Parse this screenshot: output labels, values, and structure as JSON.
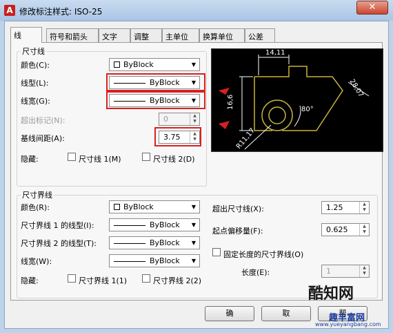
{
  "window": {
    "title": "修改标注样式: ISO-25",
    "close_glyph": "✕",
    "app_icon_letter": "A"
  },
  "tabs": [
    "线",
    "符号和箭头",
    "文字",
    "调整",
    "主单位",
    "换算单位",
    "公差"
  ],
  "dimension_lines": {
    "group_title": "尺寸线",
    "color_label": "颜色(C):",
    "color_value": "ByBlock",
    "linetype_label": "线型(L):",
    "linetype_value": "ByBlock",
    "lineweight_label": "线宽(G):",
    "lineweight_value": "ByBlock",
    "extend_ticks_label": "超出标记(N):",
    "extend_ticks_value": "0",
    "baseline_spacing_label": "基线间距(A):",
    "baseline_spacing_value": "3.75",
    "suppress_label": "隐藏:",
    "suppress_dim1": "尺寸线 1(M)",
    "suppress_dim2": "尺寸线 2(D)"
  },
  "extension_lines": {
    "group_title": "尺寸界线",
    "color_label": "颜色(R):",
    "color_value": "ByBlock",
    "ext1_linetype_label": "尺寸界线 1 的线型(I):",
    "ext1_linetype_value": "ByBlock",
    "ext2_linetype_label": "尺寸界线 2 的线型(T):",
    "ext2_linetype_value": "ByBlock",
    "lineweight_label": "线宽(W):",
    "lineweight_value": "ByBlock",
    "suppress_label": "隐藏:",
    "suppress_ext1": "尺寸界线 1(1)",
    "suppress_ext2": "尺寸界线 2(2)",
    "extend_beyond_label": "超出尺寸线(X):",
    "extend_beyond_value": "1.25",
    "offset_origin_label": "起点偏移量(F):",
    "offset_origin_value": "0.625",
    "fixed_length_label": "固定长度的尺寸界线(O)",
    "length_label": "长度(E):",
    "length_value": "1"
  },
  "preview": {
    "dim_top": "14,11",
    "dim_left": "16,6",
    "dim_right": "28,07",
    "dim_angle": "80°",
    "dim_radius": "R11,17"
  },
  "buttons": {
    "ok": "确",
    "cancel": "取",
    "help": "帮"
  },
  "watermark": {
    "text1": "酷知网",
    "text2": "趣丰富网",
    "url": "www.yueyangbang.com"
  },
  "colors": {
    "highlight": "#d82020",
    "preview_bg": "#000000",
    "preview_lines": "#c8b43c",
    "dim_lines": "#ffffff"
  }
}
